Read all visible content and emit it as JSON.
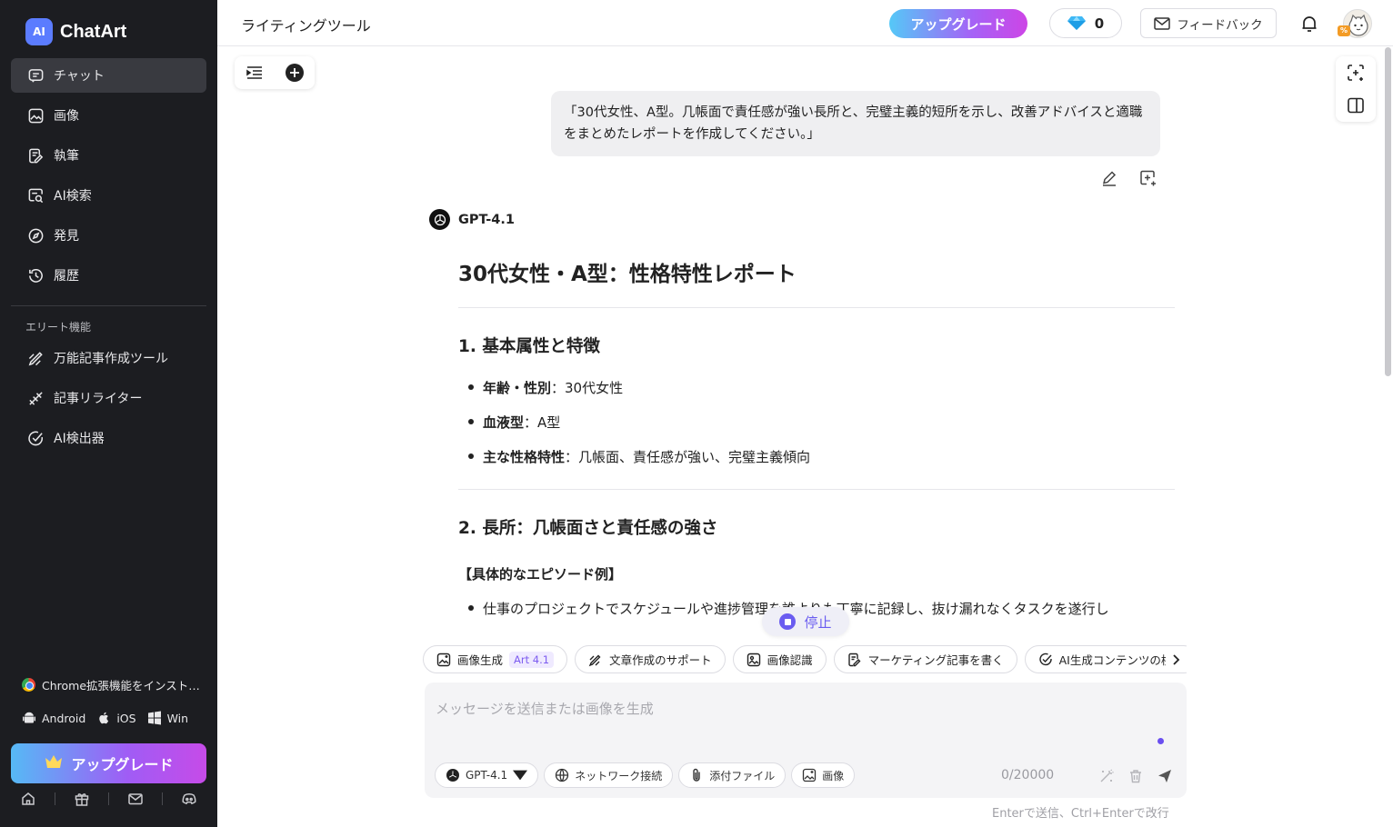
{
  "brand": {
    "name": "ChatArt",
    "logo_text": "AI"
  },
  "sidebar": {
    "items": [
      {
        "label": "チャット",
        "icon": "chat-icon",
        "active": true
      },
      {
        "label": "画像",
        "icon": "image-icon",
        "active": false
      },
      {
        "label": "執筆",
        "icon": "writing-icon",
        "active": false
      },
      {
        "label": "AI検索",
        "icon": "ai-search-icon",
        "active": false
      },
      {
        "label": "発見",
        "icon": "compass-icon",
        "active": false
      },
      {
        "label": "履歴",
        "icon": "history-icon",
        "active": false
      }
    ],
    "elite_label": "エリート機能",
    "elite_items": [
      {
        "label": "万能記事作成ツール",
        "icon": "article-tool-icon"
      },
      {
        "label": "記事リライター",
        "icon": "rewriter-icon"
      },
      {
        "label": "AI検出器",
        "icon": "ai-detector-icon"
      }
    ],
    "chrome_ext": "Chrome拡張機能をインスト…",
    "os": {
      "android": "Android",
      "ios": "iOS",
      "win": "Win"
    },
    "upgrade_label": "アップグレード"
  },
  "header": {
    "title": "ライティングツール",
    "upgrade_label": "アップグレード",
    "gems": "0",
    "feedback_label": "フィードバック",
    "avatar_badge": "%"
  },
  "chat": {
    "user_message": "「30代女性、A型。几帳面で責任感が強い長所と、完璧主義的短所を示し、改善アドバイスと適職をまとめたレポートを作成してください。」",
    "model_name": "GPT-4.1",
    "report": {
      "title": "30代女性・A型：性格特性レポート",
      "section1_title": "1. 基本属性と特徴",
      "bullets": [
        {
          "key": "年齢・性別",
          "value": "：30代女性"
        },
        {
          "key": "血液型",
          "value": "：A型"
        },
        {
          "key": "主な性格特性",
          "value": "：几帳面、責任感が強い、完璧主義傾向"
        }
      ],
      "section2_title": "2. 長所：几帳面さと責任感の強さ",
      "episode_label": "【具体的なエピソード例】",
      "episode_bullet": "仕事のプロジェクトでスケジュールや進捗管理を誰よりも丁寧に記録し、抜け漏れなくタスクを遂行し"
    },
    "stop_label": "停止"
  },
  "chips": [
    {
      "label": "画像生成",
      "badge": "Art 4.1",
      "icon": "image-gen-icon"
    },
    {
      "label": "文章作成のサポート",
      "icon": "pen-icon"
    },
    {
      "label": "画像認識",
      "icon": "image-recog-icon"
    },
    {
      "label": "マーケティング記事を書く",
      "icon": "doc-icon"
    },
    {
      "label": "AI生成コンテンツの検出",
      "icon": "check-circle-icon"
    }
  ],
  "composer": {
    "placeholder": "メッセージを送信または画像を生成",
    "model_select": "GPT-4.1",
    "network_label": "ネットワーク接続",
    "attach_label": "添付ファイル",
    "image_label": "画像",
    "counter": "0/20000",
    "hint": "Enterで送信、Ctrl+Enterで改行"
  }
}
